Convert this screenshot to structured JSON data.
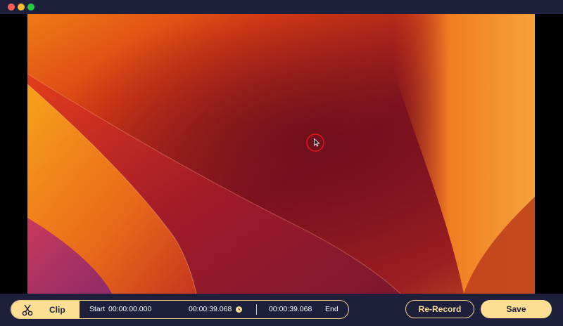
{
  "window": {
    "traffic_lights": [
      "close",
      "minimize",
      "zoom"
    ]
  },
  "preview": {
    "cursor_indicator": "cursor-click-highlight"
  },
  "clip_bar": {
    "clip_label": "Clip",
    "icon": "scissors-icon",
    "start_label": "Start",
    "start_time": "00:00:00.000",
    "current_time": "00:00:39.068",
    "current_time_icon": "clock-icon",
    "end_time": "00:00:39.068",
    "end_label": "End"
  },
  "actions": {
    "rerecord_label": "Re-Record",
    "save_label": "Save"
  },
  "colors": {
    "background": "#1d1f3b",
    "accent": "#fddf94",
    "close": "#fe5f57",
    "minimize": "#febc2e",
    "zoom": "#28c840"
  }
}
